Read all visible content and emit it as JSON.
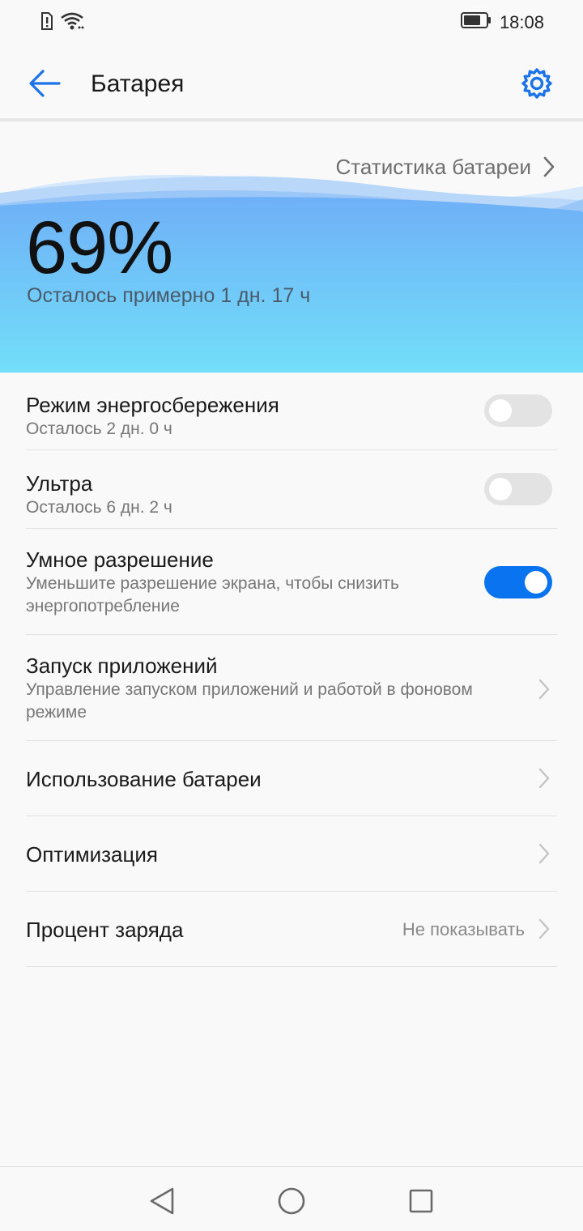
{
  "status_bar": {
    "time": "18:08",
    "icons": [
      "sim-alert-icon",
      "wifi-icon",
      "battery-icon"
    ]
  },
  "header": {
    "title": "Батарея",
    "back_icon": "arrow-left-icon",
    "settings_icon": "gear-icon",
    "accent_color": "#1a73e8"
  },
  "battery": {
    "stats_link": "Статистика батареи",
    "percent": "69%",
    "remaining": "Осталось примерно 1 дн. 17 ч",
    "gradient_top": "#6fb0f7",
    "gradient_bottom": "#72def9"
  },
  "settings": [
    {
      "title": "Режим энергосбережения",
      "subtitle": "Осталось 2 дн. 0 ч",
      "control": "toggle",
      "on": false
    },
    {
      "title": "Ультра",
      "subtitle": "Осталось 6 дн. 2 ч",
      "control": "toggle",
      "on": false
    },
    {
      "title": "Умное разрешение",
      "subtitle": "Уменьшите разрешение экрана, чтобы снизить энергопотребление",
      "control": "toggle",
      "on": true
    },
    {
      "title": "Запуск приложений",
      "subtitle": "Управление запуском приложений и работой в фоновом режиме",
      "control": "chevron"
    },
    {
      "title": "Использование батареи",
      "control": "chevron"
    },
    {
      "title": "Оптимизация",
      "control": "chevron"
    },
    {
      "title": "Процент заряда",
      "value": "Не показывать",
      "control": "chevron"
    }
  ],
  "nav_bar": {
    "icons": [
      "nav-back-icon",
      "nav-home-icon",
      "nav-recents-icon"
    ]
  }
}
